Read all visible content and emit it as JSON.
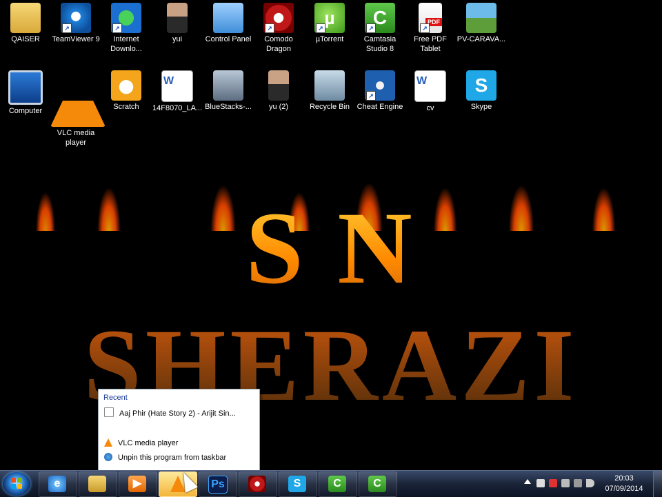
{
  "desktop": {
    "row1": [
      {
        "label": "QAISER",
        "icon": "user-folder-icon"
      },
      {
        "label": "TeamViewer 9",
        "icon": "teamviewer-icon"
      },
      {
        "label": "Internet Downlo...",
        "icon": "internet-download-manager-icon"
      },
      {
        "label": "yui",
        "icon": "person-photo-icon"
      },
      {
        "label": "Control Panel",
        "icon": "control-panel-icon"
      },
      {
        "label": "Comodo Dragon",
        "icon": "comodo-dragon-icon"
      },
      {
        "label": "µTorrent",
        "icon": "utorrent-icon"
      },
      {
        "label": "Camtasia Studio 8",
        "icon": "camtasia-icon"
      },
      {
        "label": "Free PDF Tablet",
        "icon": "pdf-icon"
      },
      {
        "label": "PV-CARAVA...",
        "icon": "landscape-image-icon"
      }
    ],
    "row2": [
      {
        "label": "Computer",
        "icon": "computer-icon"
      },
      {
        "label": "VLC media player",
        "icon": "vlc-icon"
      },
      {
        "label": "Scratch",
        "icon": "scratch-icon"
      },
      {
        "label": "14F8070_LA...",
        "icon": "word-document-icon"
      },
      {
        "label": "BlueStacks-...",
        "icon": "bluestacks-installer-icon"
      },
      {
        "label": "yu (2)",
        "icon": "person-photo-icon"
      },
      {
        "label": "Recycle Bin",
        "icon": "recycle-bin-icon"
      },
      {
        "label": "Cheat Engine",
        "icon": "cheat-engine-icon"
      },
      {
        "label": "cv",
        "icon": "word-document-icon"
      },
      {
        "label": "Skype",
        "icon": "skype-icon"
      }
    ],
    "wallpaper_text": "S N SHERAZI"
  },
  "jumplist": {
    "header": "Recent",
    "recent_item": "Aaj Phir (Hate Story 2) - Arijit Sin...",
    "app_item": "VLC media player",
    "unpin_item": "Unpin this program from taskbar"
  },
  "taskbar": {
    "buttons": [
      {
        "name": "internet-explorer",
        "glyph": "e"
      },
      {
        "name": "windows-explorer",
        "glyph": ""
      },
      {
        "name": "windows-media-player",
        "glyph": "▶"
      },
      {
        "name": "vlc",
        "glyph": ""
      },
      {
        "name": "photoshop",
        "glyph": "Ps"
      },
      {
        "name": "comodo-dragon",
        "glyph": ""
      },
      {
        "name": "skype",
        "glyph": "S"
      },
      {
        "name": "camtasia-1",
        "glyph": "C"
      },
      {
        "name": "camtasia-2",
        "glyph": "C"
      }
    ],
    "clock_time": "20:03",
    "clock_date": "07/09/2014"
  },
  "colors": {
    "taskbar": "#1a2438",
    "jumplist_header": "#1e3f9a",
    "active_button": "#f2b53a"
  }
}
